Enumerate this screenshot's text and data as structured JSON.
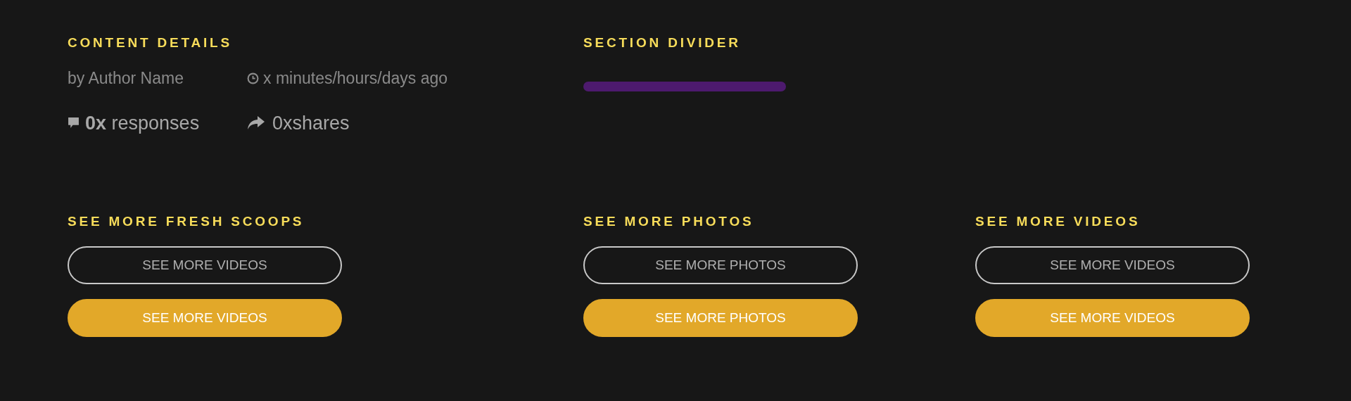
{
  "content_details": {
    "heading": "CONTENT DETAILS",
    "author": "by Author Name",
    "time": "x minutes/hours/days ago",
    "responses_count": "0x",
    "responses_label": "responses",
    "shares": "0xshares"
  },
  "section_divider": {
    "heading": "SECTION DIVIDER"
  },
  "sections": [
    {
      "heading": "SEE MORE FRESH SCOOPS",
      "buttons": [
        {
          "label": "SEE MORE VIDEOS",
          "kind": "outline"
        },
        {
          "label": "SEE MORE VIDEOS",
          "kind": "filled"
        }
      ]
    },
    {
      "heading": "SEE MORE PHOTOS",
      "buttons": [
        {
          "label": "SEE MORE PHOTOS",
          "kind": "outline"
        },
        {
          "label": "SEE MORE PHOTOS",
          "kind": "filled"
        }
      ]
    },
    {
      "heading": "SEE MORE VIDEOS",
      "buttons": [
        {
          "label": "SEE MORE VIDEOS",
          "kind": "outline"
        },
        {
          "label": "SEE MORE VIDEOS",
          "kind": "filled"
        }
      ]
    }
  ]
}
